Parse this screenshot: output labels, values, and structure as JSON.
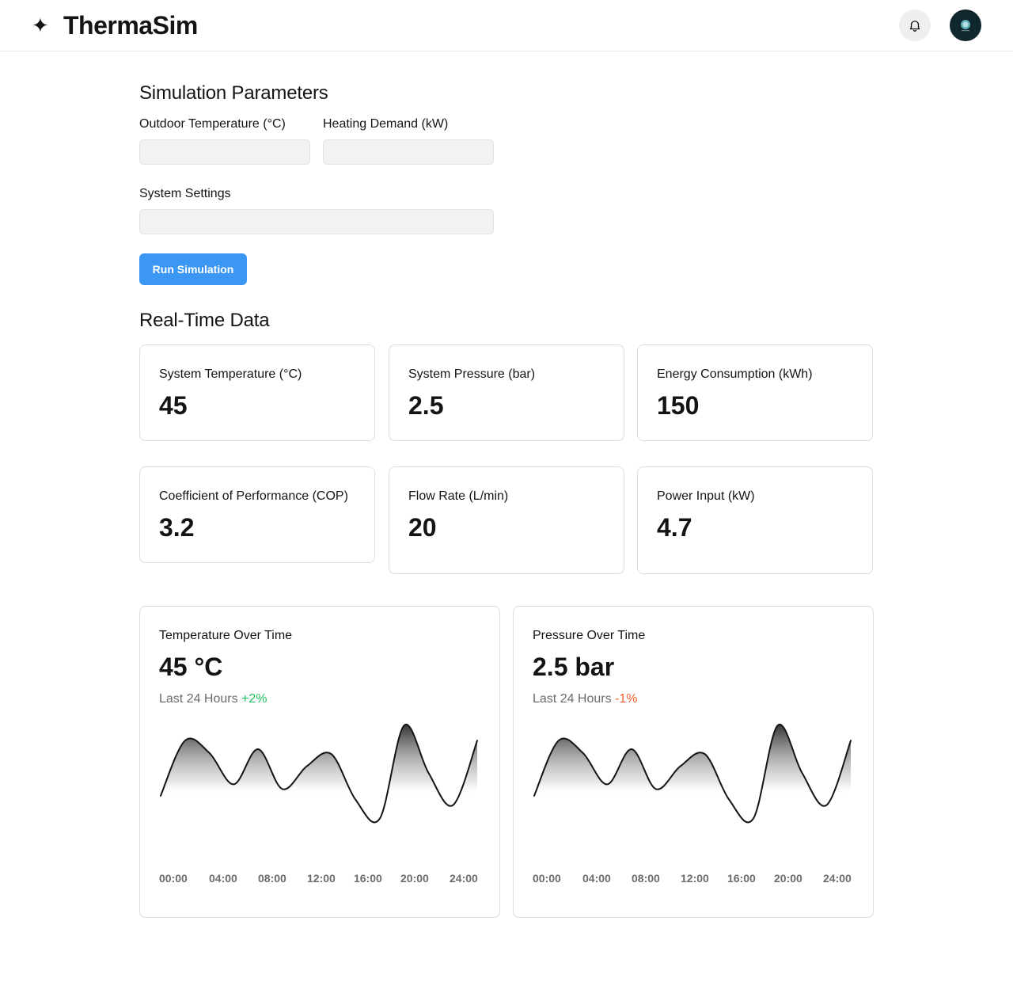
{
  "app": {
    "title": "ThermaSim",
    "logo_icon": "sparkle-icon"
  },
  "header": {
    "notification_icon": "bell-icon",
    "avatar_icon": "avatar"
  },
  "parameters": {
    "title": "Simulation Parameters",
    "outdoor_temp_label": "Outdoor Temperature (°C)",
    "outdoor_temp_value": "",
    "heating_demand_label": "Heating Demand (kW)",
    "heating_demand_value": "",
    "system_settings_label": "System Settings",
    "system_settings_value": "",
    "run_button": "Run Simulation",
    "accent_color": "#3b97f3"
  },
  "realtime": {
    "title": "Real-Time Data",
    "stats": [
      {
        "label": "System Temperature (°C)",
        "value": "45"
      },
      {
        "label": "System Pressure (bar)",
        "value": "2.5"
      },
      {
        "label": "Energy Consumption (kWh)",
        "value": "150"
      },
      {
        "label": "Coefficient of Performance (COP)",
        "value": "3.2"
      },
      {
        "label": "Flow Rate (L/min)",
        "value": "20"
      },
      {
        "label": "Power Input (kW)",
        "value": "4.7"
      }
    ]
  },
  "charts": [
    {
      "title": "Temperature Over Time",
      "value": "45 °C",
      "period": "Last 24 Hours",
      "change": "+2%",
      "change_color": "#1ec461"
    },
    {
      "title": "Pressure Over Time",
      "value": "2.5 bar",
      "period": "Last 24 Hours",
      "change": "-1%",
      "change_color": "#f0622b"
    }
  ],
  "chart_data": [
    {
      "type": "area",
      "title": "Temperature Over Time",
      "x": [
        "00:00",
        "04:00",
        "08:00",
        "12:00",
        "16:00",
        "20:00",
        "24:00"
      ],
      "xlabel": "",
      "ylabel": "",
      "grid": false,
      "relative_values": [
        0.26,
        0.84,
        0.71,
        0.38,
        0.75,
        0.33,
        0.57,
        0.7,
        0.22,
        0.02,
        1.0,
        0.5,
        0.16,
        0.84
      ]
    },
    {
      "type": "area",
      "title": "Pressure Over Time",
      "x": [
        "00:00",
        "04:00",
        "08:00",
        "12:00",
        "16:00",
        "20:00",
        "24:00"
      ],
      "xlabel": "",
      "ylabel": "",
      "grid": false,
      "relative_values": [
        0.26,
        0.84,
        0.71,
        0.38,
        0.75,
        0.33,
        0.57,
        0.7,
        0.22,
        0.02,
        1.0,
        0.5,
        0.16,
        0.84
      ]
    }
  ]
}
